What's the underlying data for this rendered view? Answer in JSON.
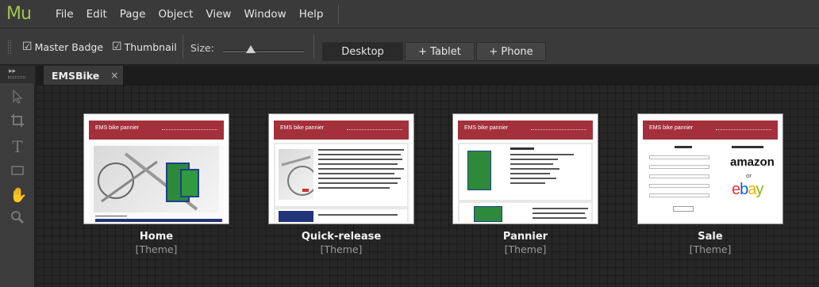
{
  "app": {
    "logo": "Mu"
  },
  "menu": [
    "File",
    "Edit",
    "Page",
    "Object",
    "View",
    "Window",
    "Help"
  ],
  "toolbar": {
    "master_badge": {
      "label": "Master Badge",
      "checked": true
    },
    "thumbnail": {
      "label": "Thumbnail",
      "checked": true
    },
    "size_label": "Size:",
    "size_value": 0.3,
    "views": [
      "Desktop",
      "+ Tablet",
      "+ Phone"
    ],
    "active_view": "Desktop"
  },
  "tab": {
    "title": "EMSBike",
    "close": "×"
  },
  "tools": [
    "selection-tool-icon",
    "crop-tool-icon",
    "text-tool-icon",
    "rectangle-tool-icon",
    "hand-tool-icon",
    "zoom-tool-icon"
  ],
  "pages": [
    {
      "name": "Home",
      "theme": "[Theme]",
      "site_title": "EMS bike pannier"
    },
    {
      "name": "Quick-release",
      "theme": "[Theme]",
      "site_title": "EMS bike pannier"
    },
    {
      "name": "Pannier",
      "theme": "[Theme]",
      "site_title": "EMS bike pannier"
    },
    {
      "name": "Sale",
      "theme": "[Theme]",
      "site_title": "EMS bike pannier",
      "logos": [
        "amazon",
        "ebay"
      ]
    }
  ],
  "colors": {
    "accent": "#a8c14f",
    "header": "#a3303a",
    "background": "#262626"
  }
}
